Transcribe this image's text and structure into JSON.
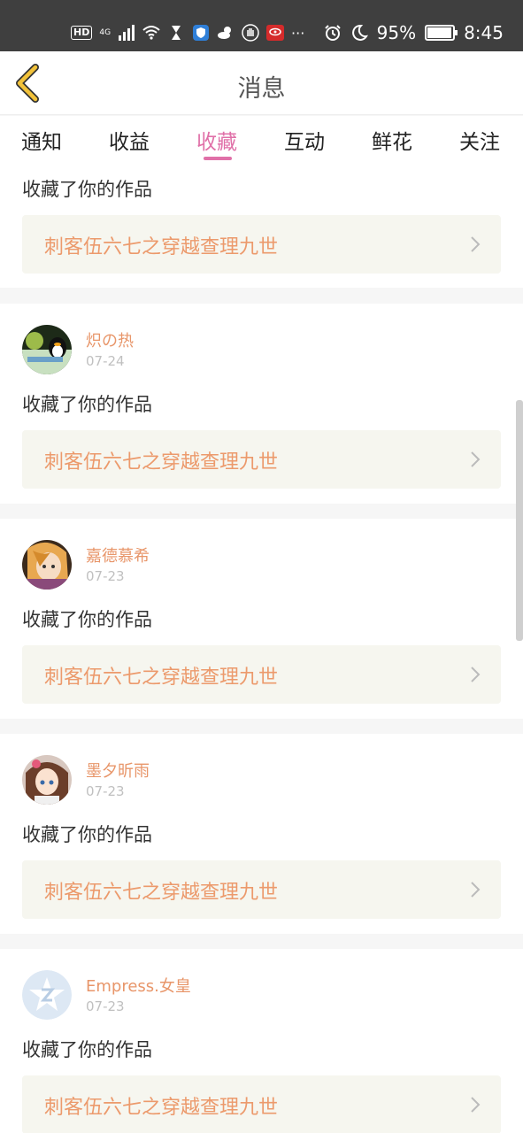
{
  "status_bar": {
    "left_badges": [
      "HD",
      "4G"
    ],
    "more": "···",
    "battery": "95%",
    "time": "8:45",
    "icons": [
      "signal-icon",
      "wifi-icon",
      "hourglass-icon",
      "shield-icon",
      "weather-icon",
      "hand-icon",
      "app-icon",
      "alarm-icon",
      "moon-icon",
      "battery-icon"
    ]
  },
  "header": {
    "title": "消息",
    "back_icon": "chevron-left-icon"
  },
  "tabs": [
    {
      "label": "通知",
      "active": false
    },
    {
      "label": "收益",
      "active": false
    },
    {
      "label": "收藏",
      "active": true
    },
    {
      "label": "互动",
      "active": false
    },
    {
      "label": "鲜花",
      "active": false
    },
    {
      "label": "关注",
      "active": false
    }
  ],
  "items": [
    {
      "user": "",
      "date": "",
      "action": "收藏了你的作品",
      "work": "刺客伍六七之穿越查理九世"
    },
    {
      "user": "炽の热",
      "date": "07-24",
      "action": "收藏了你的作品",
      "work": "刺客伍六七之穿越查理九世"
    },
    {
      "user": "嘉德慕希",
      "date": "07-23",
      "action": "收藏了你的作品",
      "work": "刺客伍六七之穿越查理九世"
    },
    {
      "user": "墨夕昕雨",
      "date": "07-23",
      "action": "收藏了你的作品",
      "work": "刺客伍六七之穿越查理九世"
    },
    {
      "user": "Empress.女皇",
      "date": "07-23",
      "action": "收藏了你的作品",
      "work": "刺客伍六七之穿越查理九世"
    }
  ],
  "colors": {
    "accent": "#e070a8",
    "username": "#e8966a",
    "work_title": "#ec9a6c",
    "work_box": "#f6f6ef"
  }
}
